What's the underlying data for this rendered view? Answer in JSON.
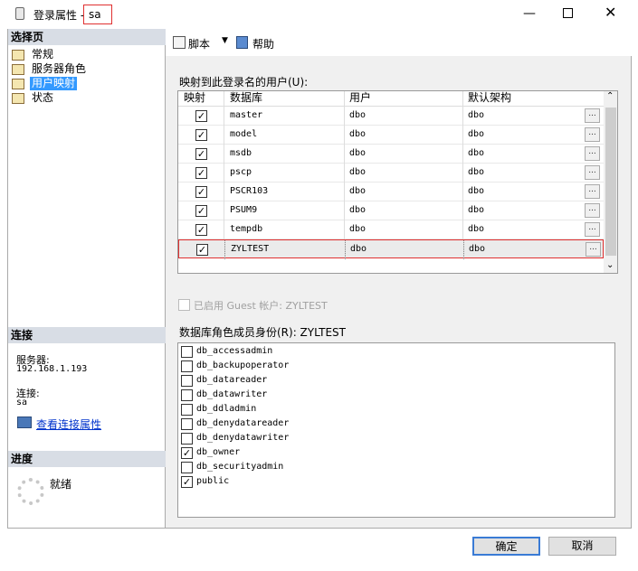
{
  "window": {
    "title_prefix": "登录属性 - ",
    "title_login": "sa"
  },
  "left": {
    "select_page": "选择页",
    "items": [
      "常规",
      "服务器角色",
      "用户映射",
      "状态"
    ],
    "connection_header": "连接",
    "server_label": "服务器:",
    "server_value": "192.168.1.193",
    "conn_label": "连接:",
    "conn_value": "sa",
    "view_link": "查看连接属性",
    "progress_header": "进度",
    "progress_status": "就绪"
  },
  "toolbar": {
    "script_label": "脚本",
    "help_label": "帮助"
  },
  "mapping": {
    "label": "映射到此登录名的用户(U):",
    "columns": [
      "映射",
      "数据库",
      "用户",
      "默认架构"
    ],
    "rows": [
      {
        "db": "master",
        "user": "dbo",
        "schema": "dbo"
      },
      {
        "db": "model",
        "user": "dbo",
        "schema": "dbo"
      },
      {
        "db": "msdb",
        "user": "dbo",
        "schema": "dbo"
      },
      {
        "db": "pscp",
        "user": "dbo",
        "schema": "dbo"
      },
      {
        "db": "PSCR103",
        "user": "dbo",
        "schema": "dbo"
      },
      {
        "db": "PSUM9",
        "user": "dbo",
        "schema": "dbo"
      },
      {
        "db": "tempdb",
        "user": "dbo",
        "schema": "dbo"
      },
      {
        "db": "ZYLTEST",
        "user": "dbo",
        "schema": "dbo"
      }
    ],
    "dots": "..."
  },
  "guest": {
    "label": "已启用 Guest 帐户: ZYLTEST"
  },
  "roles": {
    "label": "数据库角色成员身份(R): ZYLTEST",
    "items": [
      {
        "name": "db_accessadmin",
        "checked": false
      },
      {
        "name": "db_backupoperator",
        "checked": false
      },
      {
        "name": "db_datareader",
        "checked": false
      },
      {
        "name": "db_datawriter",
        "checked": false
      },
      {
        "name": "db_ddladmin",
        "checked": false
      },
      {
        "name": "db_denydatareader",
        "checked": false
      },
      {
        "name": "db_denydatawriter",
        "checked": false
      },
      {
        "name": "db_owner",
        "checked": true
      },
      {
        "name": "db_securityadmin",
        "checked": false
      },
      {
        "name": "public",
        "checked": true
      }
    ]
  },
  "footer": {
    "ok": "确定",
    "cancel": "取消"
  }
}
